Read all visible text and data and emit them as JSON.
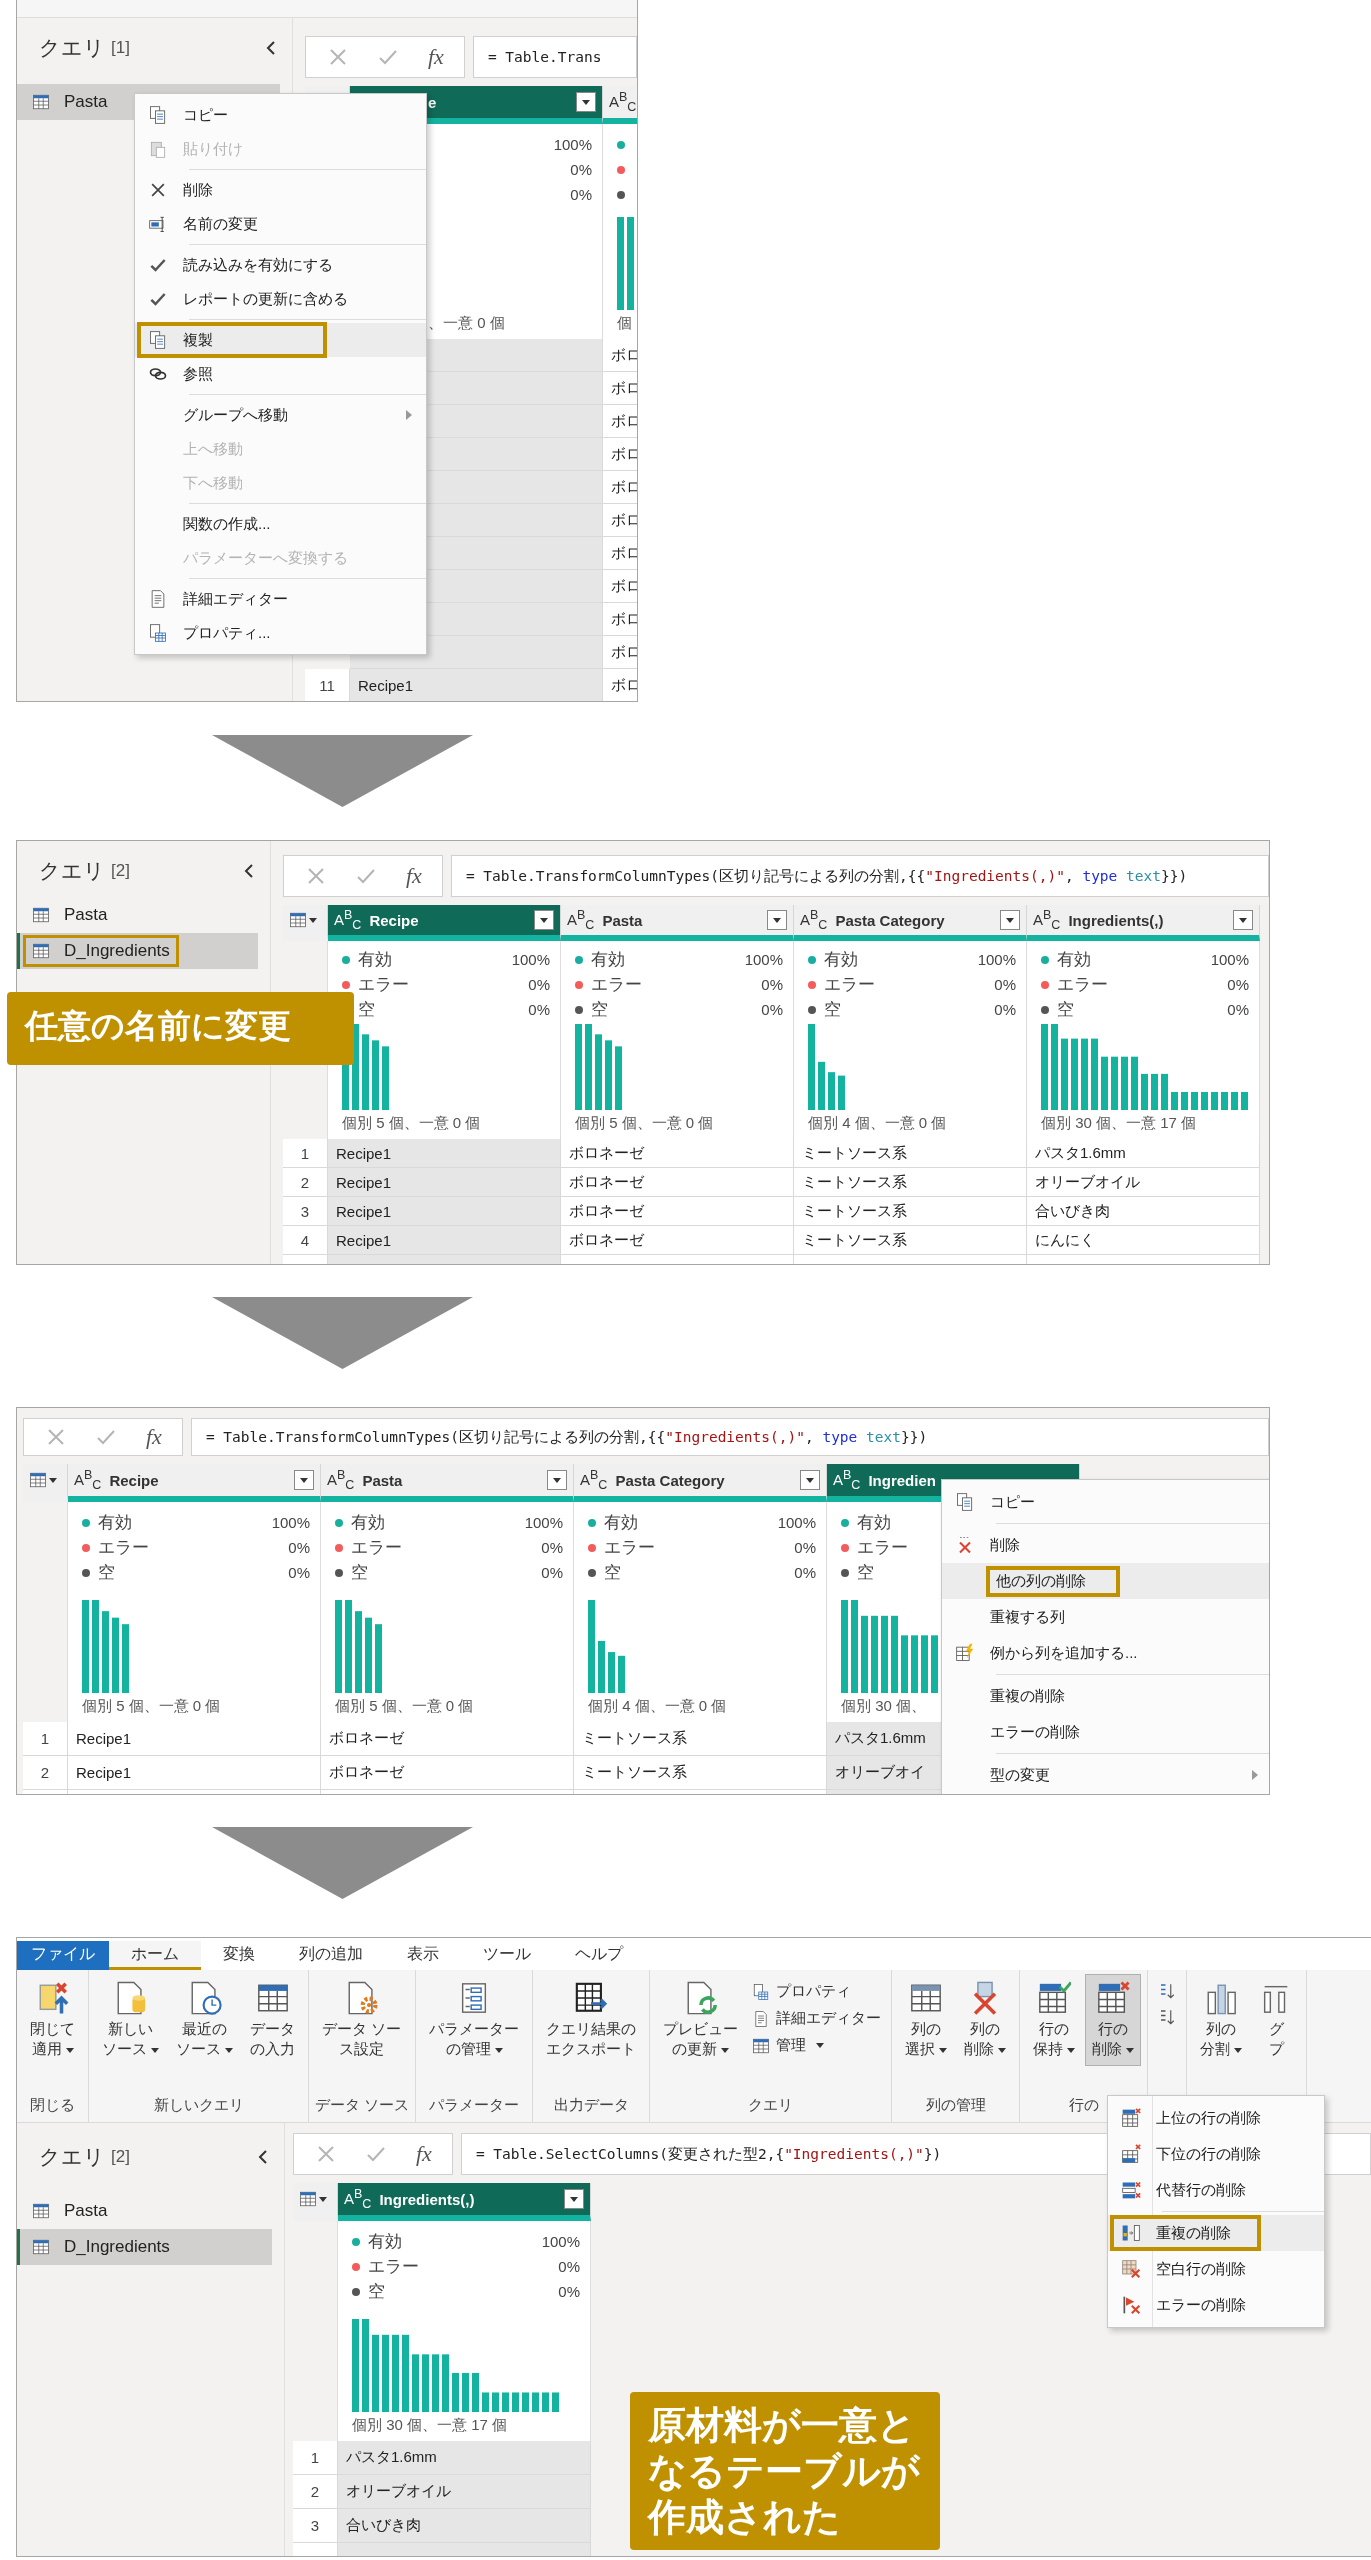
{
  "steps": [
    {
      "queries_pane": {
        "title": "クエリ",
        "count": "[1]",
        "items": [
          {
            "name": "Pasta",
            "selected": true,
            "annotated": false
          }
        ]
      },
      "formula_bar": {
        "fx": "fx",
        "tokens": [
          {
            "text": "= Table.Trans",
            "kind": "plain"
          }
        ]
      },
      "table": {
        "corner_icon": false,
        "columns": [
          {
            "label": "e",
            "selected": true,
            "dropdown": true,
            "legend": [
              {
                "value": "100%"
              },
              {
                "value": "0%"
              },
              {
                "value": "0%"
              }
            ],
            "footer": "、一意 0 個"
          },
          {
            "type": "A$^{B}$$_{C}$",
            "selected": false,
            "legend": [
              {
                "color": "#1aae9f"
              },
              {
                "color": "#f25c5c"
              },
              {
                "color": "#555555"
              }
            ],
            "footer": "個"
          }
        ],
        "rows": [
          {
            "cells": [
              "ボロ"
            ]
          },
          {
            "cells": [
              "ボロ"
            ]
          },
          {
            "cells": [
              "ボロ"
            ]
          },
          {
            "cells": [
              "ボロ"
            ]
          },
          {
            "cells": [
              "ボロ"
            ]
          },
          {
            "cells": [
              "ボロ"
            ]
          },
          {
            "cells": [
              "ボロ"
            ]
          },
          {
            "cells": [
              "ボロ"
            ]
          },
          {
            "cells": [
              "ボロ"
            ]
          },
          {
            "cells": [
              "ボロ"
            ]
          },
          {
            "number": "11",
            "cells": [
              "Recipe1",
              "ボロ"
            ]
          }
        ]
      },
      "context_menu": {
        "items": [
          {
            "label": "コピー",
            "disabled": false,
            "checked": false,
            "highlighted": false,
            "annotated": false,
            "submenu": false
          },
          {
            "label": "貼り付け",
            "disabled": true,
            "checked": false,
            "highlighted": false,
            "annotated": false,
            "submenu": false
          },
          {
            "kind": "separator"
          },
          {
            "label": "削除",
            "disabled": false,
            "checked": false,
            "highlighted": false,
            "annotated": false,
            "submenu": false
          },
          {
            "label": "名前の変更",
            "disabled": false,
            "checked": false,
            "highlighted": false,
            "annotated": false,
            "submenu": false
          },
          {
            "kind": "separator"
          },
          {
            "label": "読み込みを有効にする",
            "disabled": false,
            "checked": true,
            "highlighted": false,
            "annotated": false,
            "submenu": false
          },
          {
            "label": "レポートの更新に含める",
            "disabled": false,
            "checked": true,
            "highlighted": false,
            "annotated": false,
            "submenu": false
          },
          {
            "kind": "separator"
          },
          {
            "label": "複製",
            "disabled": false,
            "checked": false,
            "highlighted": true,
            "annotated": true,
            "submenu": false
          },
          {
            "label": "参照",
            "disabled": false,
            "checked": false,
            "highlighted": false,
            "annotated": false,
            "submenu": false
          },
          {
            "kind": "separator"
          },
          {
            "label": "グループへ移動",
            "disabled": false,
            "checked": false,
            "highlighted": false,
            "annotated": false,
            "submenu": true
          },
          {
            "label": "上へ移動",
            "disabled": true,
            "checked": false,
            "highlighted": false,
            "annotated": false,
            "submenu": false
          },
          {
            "label": "下へ移動",
            "disabled": true,
            "checked": false,
            "highlighted": false,
            "annotated": false,
            "submenu": false
          },
          {
            "kind": "separator"
          },
          {
            "label": "関数の作成...",
            "disabled": false,
            "checked": false,
            "highlighted": false,
            "annotated": false,
            "submenu": false
          },
          {
            "label": "パラメーターへ変換する",
            "disabled": true,
            "checked": false,
            "highlighted": false,
            "annotated": false,
            "submenu": false
          },
          {
            "kind": "separator"
          },
          {
            "label": "詳細エディター",
            "disabled": false,
            "checked": false,
            "highlighted": false,
            "annotated": false,
            "submenu": false
          },
          {
            "label": "プロパティ...",
            "disabled": false,
            "checked": false,
            "highlighted": false,
            "annotated": false,
            "submenu": false
          }
        ]
      }
    },
    {
      "queries_pane": {
        "title": "クエリ",
        "count": "[2]",
        "items": [
          {
            "name": "Pasta",
            "selected": false,
            "annotated": false
          },
          {
            "name": "D_Ingredients",
            "selected": true,
            "annotated": true
          }
        ]
      },
      "formula_bar": {
        "fx": "fx",
        "tokens": [
          {
            "text": "= Table.TransformColumnTypes(区切り記号による列の分割,{{",
            "kind": "plain"
          },
          {
            "text": "\"Ingredients(,)\"",
            "kind": "string"
          },
          {
            "text": ", ",
            "kind": "plain"
          },
          {
            "text": "type",
            "kind": "keyword"
          },
          {
            "text": " text",
            "kind": "type"
          },
          {
            "text": "}})",
            "kind": "plain"
          }
        ]
      },
      "table": {
        "corner_icon": true,
        "columns": [
          {
            "type": "A$^{B}$$_{C}$",
            "label": "Recipe",
            "selected": true,
            "dropdown": true,
            "legend": [
              {
                "label": "有効",
                "value": "100%",
                "color": "#1aae9f"
              },
              {
                "label": "エラー",
                "value": "0%",
                "color": "#f25c5c"
              },
              {
                "label": "空",
                "value": "0%"
              }
            ],
            "footer": "個別 5 個、一意 0 個"
          },
          {
            "type": "A$^{B}$$_{C}$",
            "label": "Pasta",
            "selected": false,
            "dropdown": true,
            "legend": [
              {
                "label": "有効",
                "value": "100%",
                "color": "#1aae9f"
              },
              {
                "label": "エラー",
                "value": "0%",
                "color": "#f25c5c"
              },
              {
                "label": "空",
                "value": "0%",
                "color": "#555555"
              }
            ],
            "footer": "個別 5 個、一意 0 個"
          },
          {
            "type": "A$^{B}$$_{C}$",
            "label": "Pasta Category",
            "selected": false,
            "dropdown": true,
            "legend": [
              {
                "label": "有効",
                "value": "100%",
                "color": "#1aae9f"
              },
              {
                "label": "エラー",
                "value": "0%",
                "color": "#f25c5c"
              },
              {
                "label": "空",
                "value": "0%",
                "color": "#555555"
              }
            ],
            "footer": "個別 4 個、一意 0 個"
          },
          {
            "type": "A$^{B}$$_{C}$",
            "label": "Ingredients(,)",
            "selected": false,
            "dropdown": true,
            "legend": [
              {
                "label": "有効",
                "value": "100%",
                "color": "#1aae9f"
              },
              {
                "label": "エラー",
                "value": "0%",
                "color": "#f25c5c"
              },
              {
                "label": "空",
                "value": "0%",
                "color": "#555555"
              }
            ],
            "footer": "個別 30 個、一意 17 個"
          }
        ],
        "rows": [
          {
            "number": "1",
            "cells": [
              "Recipe1",
              "ボロネーゼ",
              "ミートソース系",
              "パスタ1.6mm"
            ]
          },
          {
            "number": "2",
            "cells": [
              "Recipe1",
              "ボロネーゼ",
              "ミートソース系",
              "オリーブオイル"
            ]
          },
          {
            "number": "3",
            "cells": [
              "Recipe1",
              "ボロネーゼ",
              "ミートソース系",
              "合いびき肉"
            ]
          },
          {
            "number": "4",
            "cells": [
              "Recipe1",
              "ボロネーゼ",
              "ミートソース系",
              "にんにく"
            ]
          }
        ]
      },
      "callout": {
        "lines": [
          "任意の名前に変更"
        ]
      }
    },
    {
      "formula_bar": {
        "fx": "fx",
        "tokens": [
          {
            "text": "= Table.TransformColumnTypes(区切り記号による列の分割,{{",
            "kind": "plain"
          },
          {
            "text": "\"Ingredients(,)\"",
            "kind": "string"
          },
          {
            "text": ", ",
            "kind": "plain"
          },
          {
            "text": "type",
            "kind": "keyword"
          },
          {
            "text": " text",
            "kind": "type"
          },
          {
            "text": "}})",
            "kind": "plain"
          }
        ]
      },
      "table": {
        "corner_icon": true,
        "columns": [
          {
            "type": "A$^{B}$$_{C}$",
            "label": "Recipe",
            "selected": false,
            "dropdown": true,
            "legend": [
              {
                "label": "有効",
                "value": "100%",
                "color": "#1aae9f"
              },
              {
                "label": "エラー",
                "value": "0%",
                "color": "#f25c5c"
              },
              {
                "label": "空",
                "value": "0%",
                "color": "#555555"
              }
            ],
            "footer": "個別 5 個、一意 0 個"
          },
          {
            "type": "A$^{B}$$_{C}$",
            "label": "Pasta",
            "selected": false,
            "dropdown": true,
            "legend": [
              {
                "label": "有効",
                "value": "100%",
                "color": "#1aae9f"
              },
              {
                "label": "エラー",
                "value": "0%",
                "color": "#f25c5c"
              },
              {
                "label": "空",
                "value": "0%",
                "color": "#555555"
              }
            ],
            "footer": "個別 5 個、一意 0 個"
          },
          {
            "type": "A$^{B}$$_{C}$",
            "label": "Pasta Category",
            "selected": false,
            "dropdown": true,
            "legend": [
              {
                "label": "有効",
                "value": "100%",
                "color": "#1aae9f"
              },
              {
                "label": "エラー",
                "value": "0%",
                "color": "#f25c5c"
              },
              {
                "label": "空",
                "value": "0%",
                "color": "#555555"
              }
            ],
            "footer": "個別 4 個、一意 0 個"
          },
          {
            "type": "A$^{B}$$_{C}$",
            "label": "Ingredien",
            "selected": true,
            "dropdown": false,
            "legend": [
              {
                "label": "有効",
                "color": "#1aae9f"
              },
              {
                "label": "エラー",
                "color": "#f25c5c"
              },
              {
                "label": "空",
                "color": "#555555"
              }
            ],
            "footer": "個別 30 個、"
          }
        ],
        "rows": [
          {
            "number": "1",
            "cells": [
              "Recipe1",
              "ボロネーゼ",
              "ミートソース系",
              "パスタ1.6mm"
            ]
          },
          {
            "number": "2",
            "cells": [
              "Recipe1",
              "ボロネーゼ",
              "ミートソース系",
              "オリーブオイ"
            ]
          }
        ]
      },
      "context_menu": {
        "items": [
          {
            "label": "コピー",
            "highlighted": false,
            "annotated": false,
            "submenu": false
          },
          {
            "kind": "separator"
          },
          {
            "label": "削除",
            "highlighted": false,
            "annotated": false,
            "submenu": false
          },
          {
            "label": "他の列の削除",
            "highlighted": true,
            "annotated": true,
            "submenu": false
          },
          {
            "label": "重複する列",
            "highlighted": false,
            "annotated": false,
            "submenu": false
          },
          {
            "label": "例から列を追加する...",
            "highlighted": false,
            "annotated": false,
            "submenu": false
          },
          {
            "kind": "separator"
          },
          {
            "label": "重複の削除",
            "highlighted": false,
            "annotated": false,
            "submenu": false
          },
          {
            "label": "エラーの削除",
            "highlighted": false,
            "annotated": false,
            "submenu": false
          },
          {
            "kind": "separator"
          },
          {
            "label": "型の変更",
            "highlighted": false,
            "annotated": false,
            "submenu": true
          }
        ]
      }
    },
    {
      "ribbon": {
        "tabs": [
          {
            "label": "ファイル",
            "kind": "file",
            "selected": false
          },
          {
            "label": "ホーム",
            "kind": "tab",
            "selected": true
          },
          {
            "label": "変換",
            "kind": "tab",
            "selected": false
          },
          {
            "label": "列の追加",
            "kind": "tab",
            "selected": false
          },
          {
            "label": "表示",
            "kind": "tab",
            "selected": false
          },
          {
            "label": "ツール",
            "kind": "tab",
            "selected": false
          },
          {
            "label": "ヘルプ",
            "kind": "tab",
            "selected": false
          }
        ],
        "groups": [
          {
            "label": "閉じる",
            "buttons": [
              {
                "lines": [
                  "閉じて",
                  "適用"
                ],
                "dropdown": true,
                "pressed": false
              }
            ]
          },
          {
            "label": "新しいクエリ",
            "buttons": [
              {
                "lines": [
                  "新しい",
                  "ソース"
                ],
                "dropdown": true,
                "pressed": false
              },
              {
                "lines": [
                  "最近の",
                  "ソース"
                ],
                "dropdown": true,
                "pressed": false
              },
              {
                "lines": [
                  "データ",
                  "の入力"
                ],
                "dropdown": false,
                "pressed": false
              }
            ]
          },
          {
            "label": "データ ソース",
            "buttons": [
              {
                "lines": [
                  "データ ソー",
                  "ス設定"
                ],
                "dropdown": false,
                "pressed": false
              }
            ]
          },
          {
            "label": "パラメーター",
            "buttons": [
              {
                "lines": [
                  "パラメーター",
                  "の管理"
                ],
                "dropdown": true,
                "pressed": false
              }
            ]
          },
          {
            "label": "出力データ",
            "buttons": [
              {
                "lines": [
                  "クエリ結果の",
                  "エクスポート"
                ],
                "dropdown": false,
                "pressed": false
              }
            ]
          },
          {
            "label": "クエリ",
            "buttons": [
              {
                "lines": [
                  "プレビュー",
                  "の更新"
                ],
                "dropdown": true,
                "pressed": false
              }
            ],
            "small_buttons": [
              {
                "label": "プロパティ",
                "dropdown": false
              },
              {
                "label": "詳細エディター",
                "dropdown": false
              },
              {
                "label": "管理",
                "dropdown": true
              }
            ]
          },
          {
            "label": "列の管理",
            "buttons": [
              {
                "lines": [
                  "列の",
                  "選択"
                ],
                "dropdown": true,
                "pressed": false
              },
              {
                "lines": [
                  "列の",
                  "削除"
                ],
                "dropdown": true,
                "pressed": false
              }
            ]
          },
          {
            "label": "行の",
            "buttons": [
              {
                "lines": [
                  "行の",
                  "保持"
                ],
                "dropdown": true,
                "pressed": false
              },
              {
                "lines": [
                  "行の",
                  "削除"
                ],
                "dropdown": true,
                "pressed": true
              }
            ]
          },
          {
            "small_buttons": [
              {
                "dropdown": false
              },
              {
                "dropdown": false
              }
            ]
          },
          {
            "buttons": [
              {
                "lines": [
                  "列の",
                  "分割"
                ],
                "dropdown": true,
                "pressed": false
              },
              {
                "lines": [
                  "グ",
                  "プ"
                ],
                "dropdown": false,
                "pressed": false
              }
            ]
          }
        ]
      },
      "queries_pane": {
        "title": "クエリ",
        "count": "[2]",
        "items": [
          {
            "name": "Pasta",
            "selected": false,
            "annotated": false
          },
          {
            "name": "D_Ingredients",
            "selected": true,
            "annotated": false
          }
        ]
      },
      "formula_bar": {
        "fx": "fx",
        "tokens": [
          {
            "text": "= Table.SelectColumns(変更された型2,{",
            "kind": "plain"
          },
          {
            "text": "\"Ingredients(,)\"",
            "kind": "string"
          },
          {
            "text": "})",
            "kind": "plain"
          }
        ]
      },
      "table": {
        "corner_icon": true,
        "columns": [
          {
            "type": "A$^{B}$$_{C}$",
            "label": "Ingredients(,)",
            "selected": true,
            "dropdown": true,
            "legend": [
              {
                "label": "有効",
                "value": "100%",
                "color": "#1aae9f"
              },
              {
                "label": "エラー",
                "value": "0%",
                "color": "#f25c5c"
              },
              {
                "label": "空",
                "value": "0%",
                "color": "#555555"
              }
            ],
            "footer": "個別 30 個、一意 17 個"
          }
        ],
        "rows": [
          {
            "number": "1",
            "cells": [
              "パスタ1.6mm"
            ]
          },
          {
            "number": "2",
            "cells": [
              "オリーブオイル"
            ]
          },
          {
            "number": "3",
            "cells": [
              "合いびき肉"
            ]
          }
        ]
      },
      "context_menu": {
        "items": [
          {
            "label": "上位の行の削除",
            "highlighted": false,
            "annotated": false
          },
          {
            "label": "下位の行の削除",
            "highlighted": false,
            "annotated": false
          },
          {
            "label": "代替行の削除",
            "highlighted": false,
            "annotated": false
          },
          {
            "kind": "separator"
          },
          {
            "label": "重複の削除",
            "highlighted": true,
            "annotated": true
          },
          {
            "label": "空白行の削除",
            "highlighted": false,
            "annotated": false
          },
          {
            "label": "エラーの削除",
            "highlighted": false,
            "annotated": false
          }
        ]
      },
      "callout": {
        "lines": [
          "原材料が一意と",
          "なるテーブルが",
          "作成された"
        ]
      }
    }
  ]
}
